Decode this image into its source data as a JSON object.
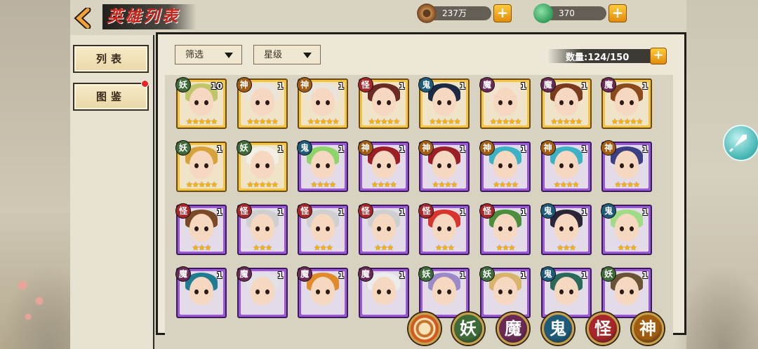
{
  "header": {
    "title": "英雄列表"
  },
  "resources": [
    {
      "name": "coin",
      "value": "237万"
    },
    {
      "name": "jade",
      "value": "370"
    }
  ],
  "nav": {
    "list_label": "列表",
    "gallery_label": "图鉴"
  },
  "filters": {
    "filter_label": "筛选",
    "star_label": "星级"
  },
  "count": {
    "label": "数量",
    "value": "124/150"
  },
  "factions": [
    {
      "label": "妖",
      "color": "#3f6b3a"
    },
    {
      "label": "魔",
      "color": "#6a2a55"
    },
    {
      "label": "鬼",
      "color": "#1e5b7a"
    },
    {
      "label": "怪",
      "color": "#a6262a"
    },
    {
      "label": "神",
      "color": "#a25c12"
    }
  ],
  "heroes": [
    {
      "faction": "妖",
      "level": "10",
      "stars": "★★★★★",
      "rarity": "gold",
      "hair": "#bfc66a"
    },
    {
      "faction": "神",
      "level": "1",
      "stars": "★★★★★",
      "rarity": "gold",
      "hair": "#e9e4dc"
    },
    {
      "faction": "神",
      "level": "1",
      "stars": "★★★★★",
      "rarity": "gold",
      "hair": "#e9e4dc"
    },
    {
      "faction": "怪",
      "level": "1",
      "stars": "★★★★★",
      "rarity": "gold",
      "hair": "#6b2a24"
    },
    {
      "faction": "鬼",
      "level": "1",
      "stars": "★★★★★",
      "rarity": "gold",
      "hair": "#1d2a44"
    },
    {
      "faction": "魔",
      "level": "1",
      "stars": "★★★★★",
      "rarity": "gold",
      "hair": "#f1e3d0"
    },
    {
      "faction": "魔",
      "level": "1",
      "stars": "★★★★★",
      "rarity": "gold",
      "hair": "#7a3a1c"
    },
    {
      "faction": "魔",
      "level": "1",
      "stars": "★★★★★",
      "rarity": "gold",
      "hair": "#8a4a1c"
    },
    {
      "faction": "妖",
      "level": "1",
      "stars": "★★★★★",
      "rarity": "gold",
      "hair": "#d7a23a"
    },
    {
      "faction": "妖",
      "level": "1",
      "stars": "★★★★★",
      "rarity": "gold",
      "hair": "#f2efe6"
    },
    {
      "faction": "鬼",
      "level": "1",
      "stars": "★★★★",
      "rarity": "purple",
      "hair": "#8dd46a"
    },
    {
      "faction": "神",
      "level": "1",
      "stars": "★★★★",
      "rarity": "purple",
      "hair": "#9c1f28"
    },
    {
      "faction": "神",
      "level": "1",
      "stars": "★★★★",
      "rarity": "purple",
      "hair": "#9c1f28"
    },
    {
      "faction": "神",
      "level": "1",
      "stars": "★★★★",
      "rarity": "purple",
      "hair": "#3cb2c7"
    },
    {
      "faction": "神",
      "level": "1",
      "stars": "★★★★",
      "rarity": "purple",
      "hair": "#3cb2c7"
    },
    {
      "faction": "神",
      "level": "1",
      "stars": "★★★★",
      "rarity": "purple",
      "hair": "#3b3f86"
    },
    {
      "faction": "怪",
      "level": "1",
      "stars": "★★★",
      "rarity": "purple",
      "hair": "#7a4a26"
    },
    {
      "faction": "怪",
      "level": "1",
      "stars": "★★★",
      "rarity": "purple",
      "hair": "#cfcfcf"
    },
    {
      "faction": "怪",
      "level": "1",
      "stars": "★★★",
      "rarity": "purple",
      "hair": "#cfcfcf"
    },
    {
      "faction": "怪",
      "level": "1",
      "stars": "★★★",
      "rarity": "purple",
      "hair": "#cfcfcf"
    },
    {
      "faction": "怪",
      "level": "1",
      "stars": "★★★",
      "rarity": "purple",
      "hair": "#d8332c"
    },
    {
      "faction": "怪",
      "level": "1",
      "stars": "★★★",
      "rarity": "purple",
      "hair": "#4b8f3e"
    },
    {
      "faction": "鬼",
      "level": "1",
      "stars": "★★★",
      "rarity": "purple",
      "hair": "#2a2538"
    },
    {
      "faction": "鬼",
      "level": "1",
      "stars": "★★★",
      "rarity": "purple",
      "hair": "#9fdc86"
    },
    {
      "faction": "魔",
      "level": "1",
      "stars": "",
      "rarity": "purple",
      "hair": "#1f7c93"
    },
    {
      "faction": "魔",
      "level": "1",
      "stars": "",
      "rarity": "purple",
      "hair": "#e2e2e6"
    },
    {
      "faction": "魔",
      "level": "1",
      "stars": "",
      "rarity": "purple",
      "hair": "#e08a2a"
    },
    {
      "faction": "魔",
      "level": "1",
      "stars": "",
      "rarity": "purple",
      "hair": "#ececec"
    },
    {
      "faction": "妖",
      "level": "1",
      "stars": "",
      "rarity": "purple",
      "hair": "#9b8ac8"
    },
    {
      "faction": "妖",
      "level": "1",
      "stars": "",
      "rarity": "purple",
      "hair": "#d8b46a"
    },
    {
      "faction": "鬼",
      "level": "1",
      "stars": "",
      "rarity": "purple",
      "hair": "#2b6a5a"
    },
    {
      "faction": "妖",
      "level": "1",
      "stars": "",
      "rarity": "purple",
      "hair": "#6a5236"
    }
  ]
}
